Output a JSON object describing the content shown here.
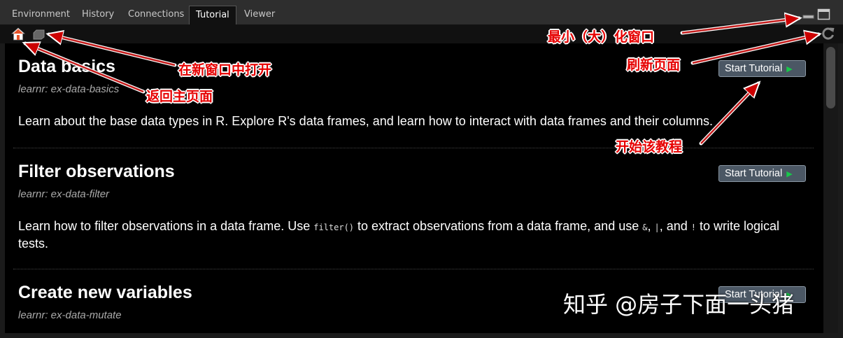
{
  "tabs": [
    {
      "label": "Environment",
      "active": false
    },
    {
      "label": "History",
      "active": false
    },
    {
      "label": "Connections",
      "active": false
    },
    {
      "label": "Tutorial",
      "active": true
    },
    {
      "label": "Viewer",
      "active": false
    }
  ],
  "tutorials": [
    {
      "title": "Data basics",
      "package": "learnr: ex-data-basics",
      "button": "Start Tutorial",
      "description": "Learn about the base data types in R. Explore R's data frames, and learn how to interact with data frames and their columns."
    },
    {
      "title": "Filter observations",
      "package": "learnr: ex-data-filter",
      "button": "Start Tutorial",
      "description_parts": [
        "Learn how to filter observations in a data frame. Use ",
        "filter()",
        " to extract observations from a data frame, and use ",
        "&",
        ", ",
        "|",
        ", and ",
        "!",
        " to write logical tests."
      ]
    },
    {
      "title": "Create new variables",
      "package": "learnr: ex-data-mutate",
      "button": "Start Tutorial"
    }
  ],
  "annotations": {
    "open_new_window": "在新窗口中打开",
    "back_home": "返回主页面",
    "min_max": "最小（大）化窗口",
    "refresh": "刷新页面",
    "start_tutorial": "开始该教程"
  },
  "watermark": "知乎 @房子下面一头猪",
  "colors": {
    "annotation": "#e60000",
    "play": "#18c74a",
    "button_bg": "#4b5764"
  },
  "icons": [
    "home-icon",
    "popout-icon",
    "minimize-icon",
    "maximize-icon",
    "refresh-icon",
    "play-icon"
  ]
}
